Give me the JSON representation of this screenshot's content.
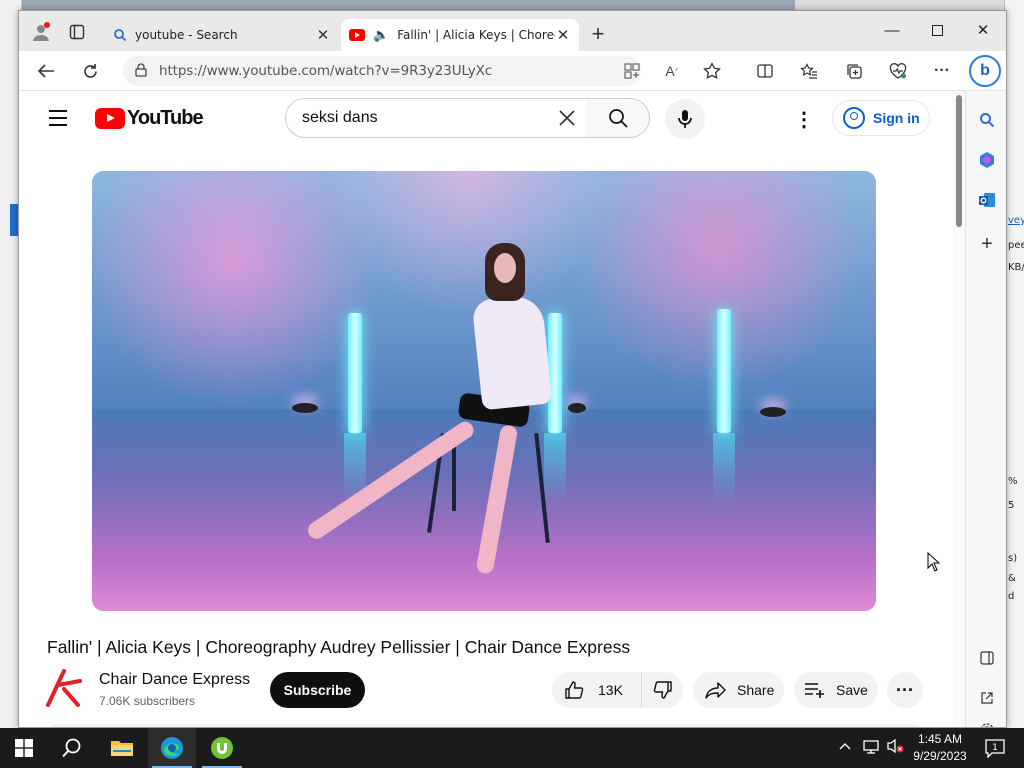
{
  "browser": {
    "tabs": [
      {
        "title": "youtube - Search",
        "active": false
      },
      {
        "title": "Fallin' | Alicia Keys | Choreog",
        "active": true
      }
    ],
    "url": "https://www.youtube.com/watch?v=9R3y23ULyXc"
  },
  "youtube": {
    "logo_text": "YouTube",
    "search_query": "seksi dans",
    "signin_label": "Sign in",
    "video_title": "Fallin' | Alicia Keys | Choreography Audrey Pellissier | Chair Dance Express",
    "channel_name": "Chair Dance Express",
    "subscribers": "7.06K subscribers",
    "subscribe_label": "Subscribe",
    "like_count": "13K",
    "share_label": "Share",
    "save_label": "Save"
  },
  "taskbar": {
    "time": "1:45 AM",
    "date": "9/29/2023",
    "notification_count": "1"
  },
  "colors": {
    "youtube_red": "#ff0000",
    "link_blue": "#065fd4",
    "taskbar": "#1b1b1b"
  },
  "background_window": {
    "fragments": [
      "vey",
      "peed",
      "KB/",
      "%",
      "5",
      "s)",
      "&",
      "d"
    ]
  }
}
